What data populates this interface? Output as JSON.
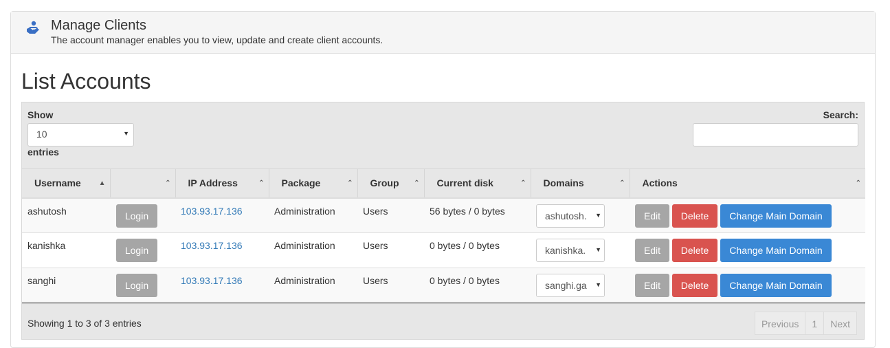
{
  "header": {
    "title": "Manage Clients",
    "subtitle": "The account manager enables you to view, update and create client accounts.",
    "icon": "hand-holding-user-icon"
  },
  "page_title": "List Accounts",
  "controls": {
    "show_label": "Show",
    "length_value": "10",
    "entries_label": "entries",
    "search_label": "Search:",
    "search_value": ""
  },
  "columns": [
    "Username",
    "",
    "IP Address",
    "Package",
    "Group",
    "Current disk",
    "Domains",
    "Actions"
  ],
  "rows": [
    {
      "username": "ashutosh",
      "login": "Login",
      "ip": "103.93.17.136",
      "package": "Administration",
      "group": "Users",
      "disk": "56 bytes / 0 bytes",
      "domain": "ashutosh.",
      "edit": "Edit",
      "delete": "Delete",
      "change": "Change Main Domain"
    },
    {
      "username": "kanishka",
      "login": "Login",
      "ip": "103.93.17.136",
      "package": "Administration",
      "group": "Users",
      "disk": "0 bytes / 0 bytes",
      "domain": "kanishka.",
      "edit": "Edit",
      "delete": "Delete",
      "change": "Change Main Domain"
    },
    {
      "username": "sanghi",
      "login": "Login",
      "ip": "103.93.17.136",
      "package": "Administration",
      "group": "Users",
      "disk": "0 bytes / 0 bytes",
      "domain": "sanghi.ga",
      "edit": "Edit",
      "delete": "Delete",
      "change": "Change Main Domain"
    }
  ],
  "footer": {
    "info": "Showing 1 to 3 of 3 entries",
    "previous": "Previous",
    "page": "1",
    "next": "Next"
  },
  "colors": {
    "link": "#337ab7",
    "delete": "#d9534f",
    "primary": "#3a88d5",
    "default": "#a6a6a6"
  }
}
